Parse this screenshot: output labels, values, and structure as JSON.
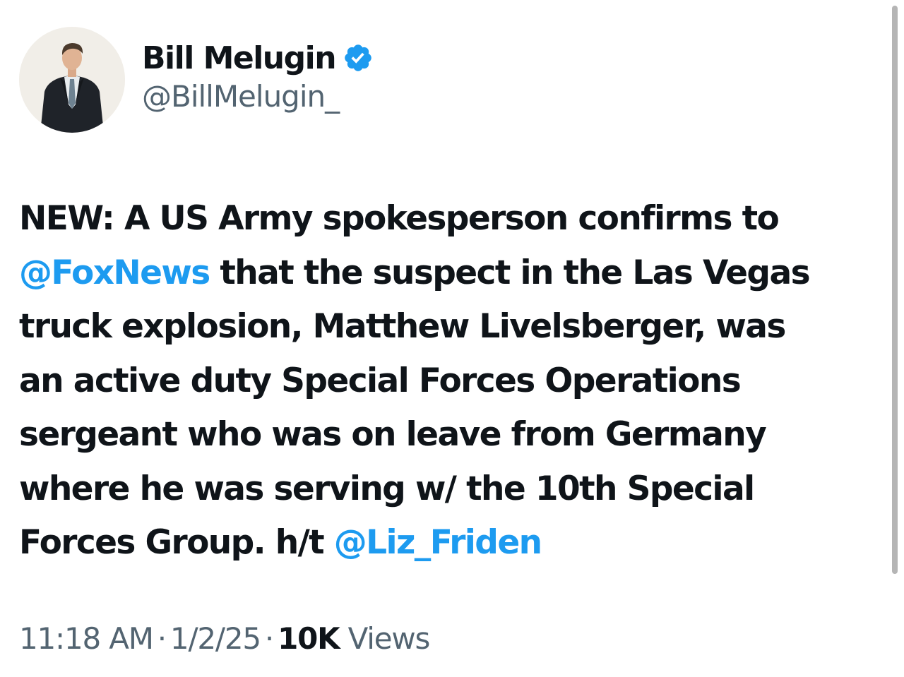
{
  "author": {
    "display_name": "Bill Melugin",
    "handle": "@BillMelugin_",
    "verified": true,
    "avatar_icon": "profile-photo"
  },
  "tweet": {
    "lines": [
      [
        {
          "text": "NEW: A US Army spokesperson confirms to",
          "mention": false
        }
      ],
      [
        {
          "text": "@FoxNews",
          "mention": true
        },
        {
          "text": " that the suspect in the Las Vegas",
          "mention": false
        }
      ],
      [
        {
          "text": "truck explosion, Matthew Livelsberger, was",
          "mention": false
        }
      ],
      [
        {
          "text": "an active duty Special Forces Operations",
          "mention": false
        }
      ],
      [
        {
          "text": "sergeant who was on leave from Germany",
          "mention": false
        }
      ],
      [
        {
          "text": "where he was serving w/ the 10th Special",
          "mention": false
        }
      ],
      [
        {
          "text": "Forces Group. h/t ",
          "mention": false
        },
        {
          "text": "@Liz_Friden",
          "mention": true
        }
      ]
    ]
  },
  "meta": {
    "time": "11:18 AM",
    "date": "1/2/25",
    "separator": "·",
    "views_count": "10K",
    "views_label": "Views"
  },
  "colors": {
    "text": "#0f1419",
    "secondary": "#536471",
    "link": "#1d9bf0",
    "verified": "#1d9bf0",
    "background": "#ffffff"
  }
}
